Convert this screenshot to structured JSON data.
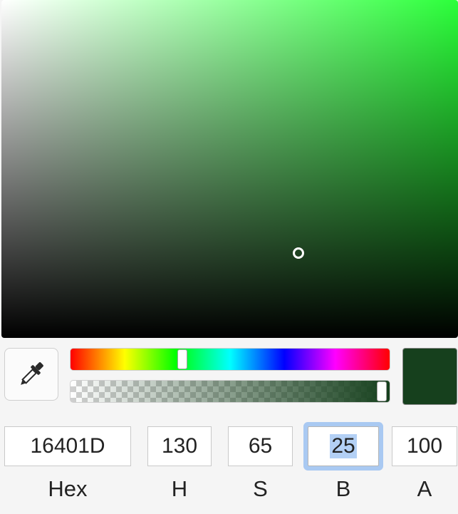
{
  "picker": {
    "hue_color": "#2bff3a",
    "current_color": "#16401D"
  },
  "icons": {
    "eyedropper": "eyedropper-icon"
  },
  "fields": {
    "hex": {
      "value": "16401D",
      "label": "Hex"
    },
    "h": {
      "value": "130",
      "label": "H"
    },
    "s": {
      "value": "65",
      "label": "S"
    },
    "b": {
      "value": "25",
      "label": "B"
    },
    "a": {
      "value": "100",
      "label": "A"
    }
  }
}
